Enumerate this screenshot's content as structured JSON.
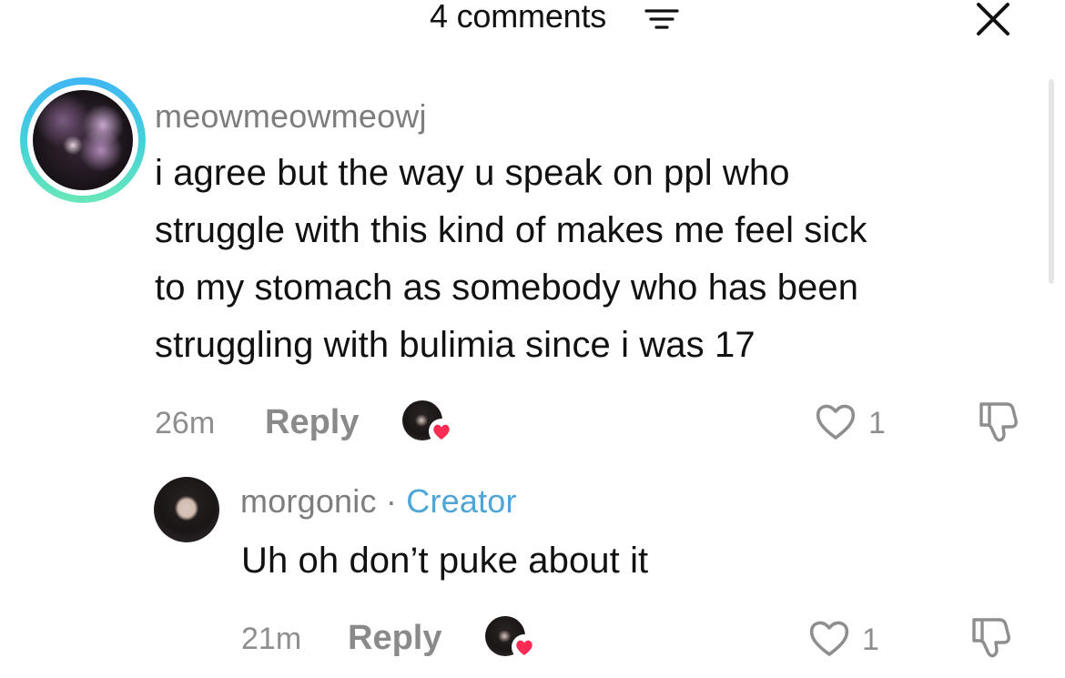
{
  "header": {
    "title": "4 comments",
    "filter_icon": "filter-lines-icon",
    "close_icon": "close-x-icon"
  },
  "comments": [
    {
      "username": "meowmeowmeowj",
      "lines": [
        "i agree but the way u speak on ppl who",
        "struggle with this kind of makes me feel sick",
        "to my stomach as somebody who has been",
        "struggling with bulimia since i was 17"
      ],
      "time": "26m",
      "reply_label": "Reply",
      "likes": "1"
    },
    {
      "username": "morgonic",
      "separator": "·",
      "badge": "Creator",
      "text": "Uh oh don’t puke about it",
      "time": "21m",
      "reply_label": "Reply",
      "likes": "1"
    }
  ],
  "colors": {
    "creator_badge": "#4ea5d6",
    "heart_badge": "#fe2c55",
    "avatar_ring_top": "#3fb6f5",
    "avatar_ring_bottom": "#6ae8b8"
  }
}
